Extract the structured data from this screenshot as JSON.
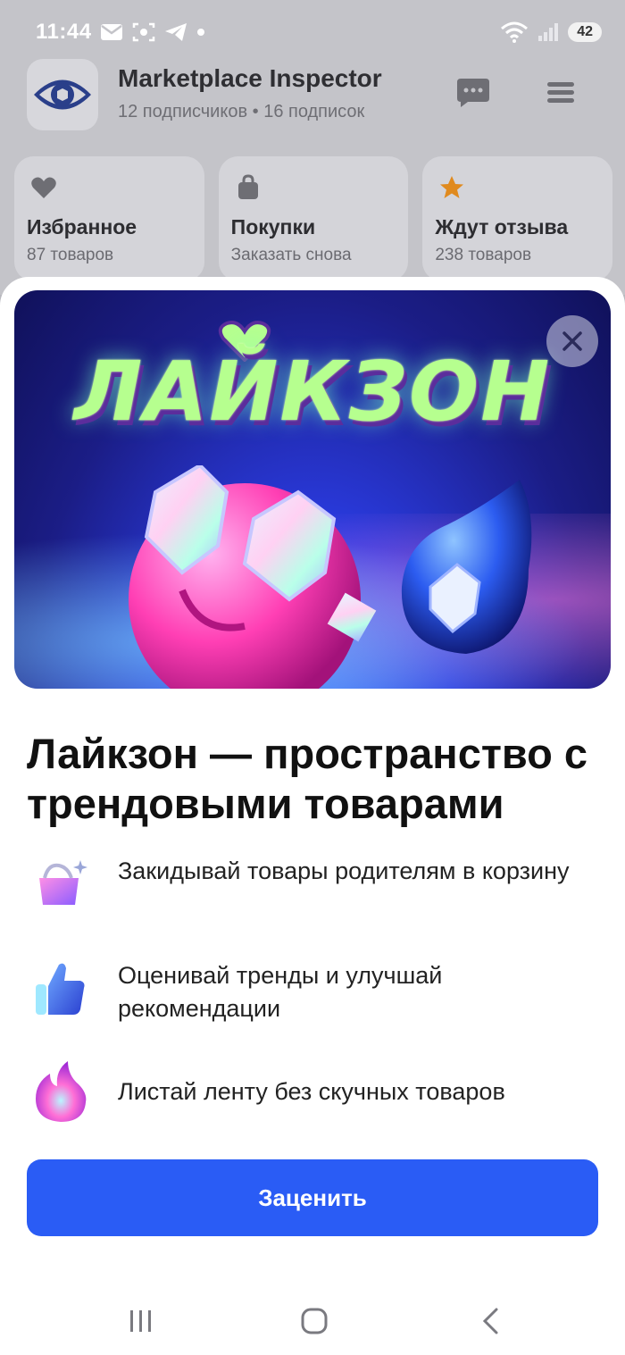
{
  "status_bar": {
    "time": "11:44",
    "battery": "42",
    "icons": [
      "mail-icon",
      "screen-record-icon",
      "telegram-icon",
      "dot-icon",
      "wifi-icon",
      "signal-icon",
      "battery-icon"
    ]
  },
  "profile": {
    "name": "Marketplace Inspector",
    "subtitle": "12 подписчиков • 16 подписок",
    "logo_icon": "eye-logo-icon",
    "chat_icon": "chat-icon",
    "menu_icon": "menu-icon"
  },
  "cards": [
    {
      "icon": "heart-icon",
      "title": "Избранное",
      "subtitle": "87 товаров"
    },
    {
      "icon": "bag-icon",
      "title": "Покупки",
      "subtitle": "Заказать снова"
    },
    {
      "icon": "star-icon",
      "title": "Ждут отзыва",
      "subtitle": "238 товаров"
    }
  ],
  "sheet": {
    "banner_logo_text": "ЛАЙКЗОН",
    "title": "Лайкзон — пространство с трендовыми товарами",
    "features": [
      {
        "icon": "basket-icon",
        "text": "Закидывай товары родителям в корзину"
      },
      {
        "icon": "thumbs-up-icon",
        "text": "Оценивай тренды и улучшай рекомендации"
      },
      {
        "icon": "fire-icon",
        "text": "Листай ленту без скучных товаров"
      }
    ],
    "cta_label": "Заценить"
  },
  "colors": {
    "accent": "#2a5cf5",
    "star": "#e08a1e"
  },
  "nav": [
    "recent-apps-icon",
    "home-icon",
    "back-icon"
  ]
}
